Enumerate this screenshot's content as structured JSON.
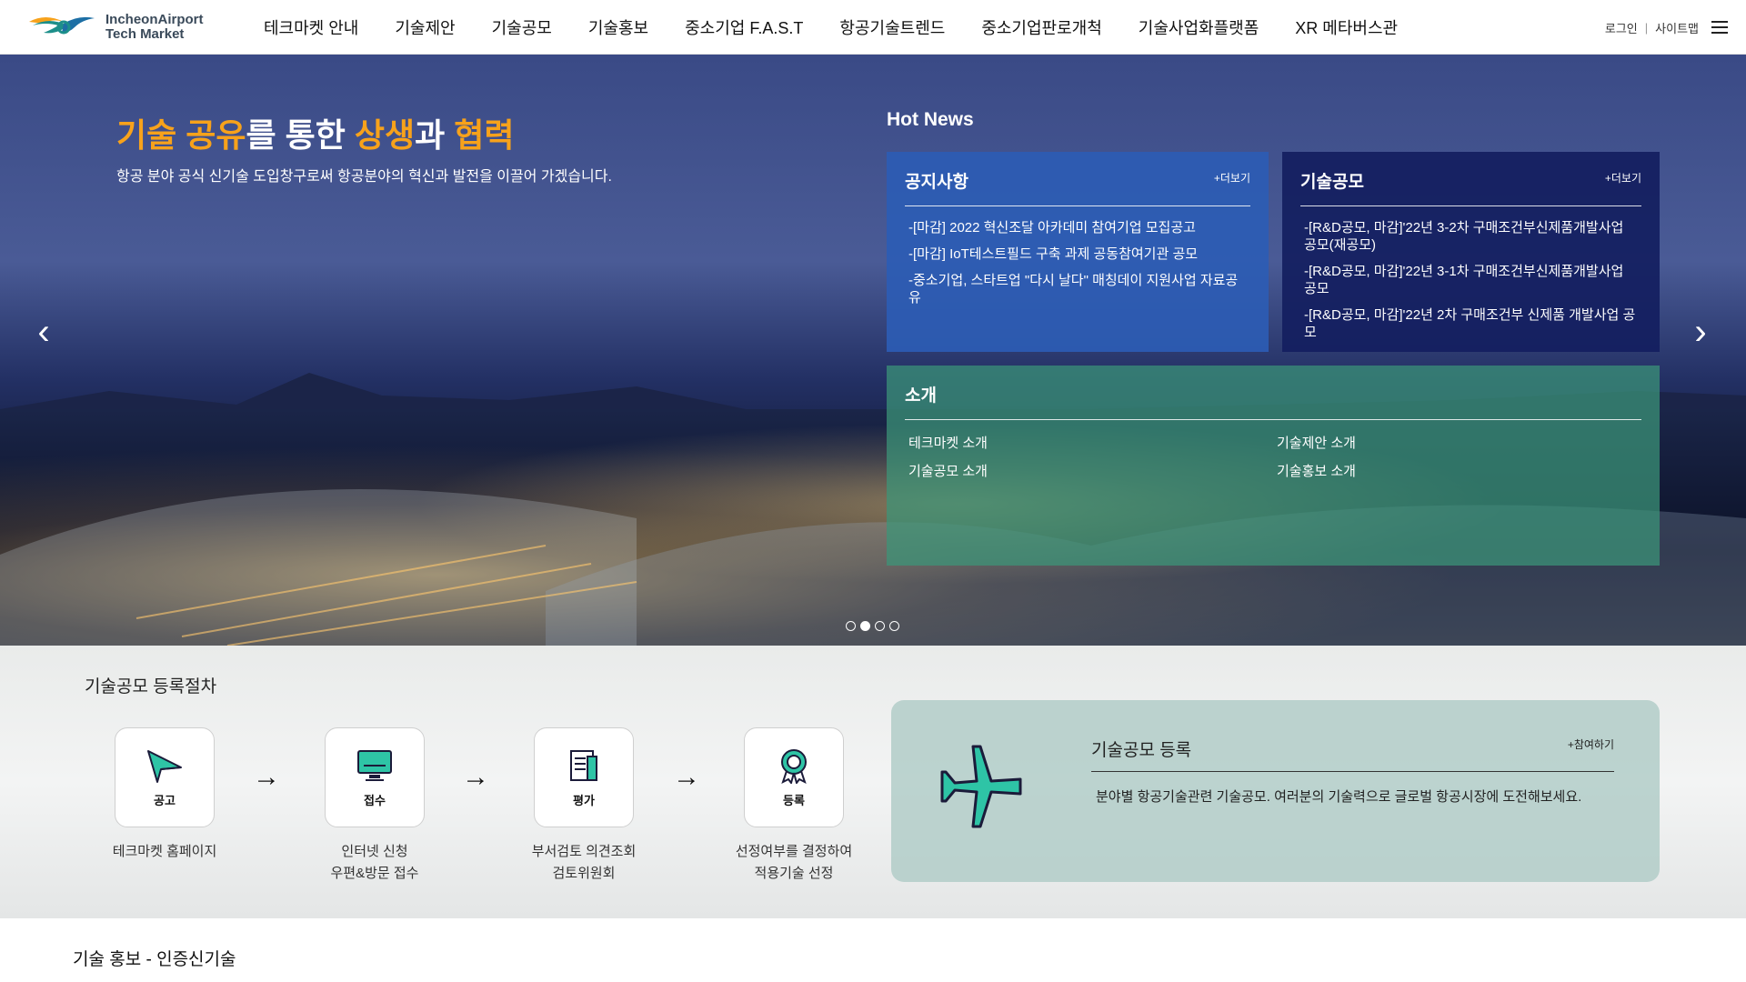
{
  "header": {
    "logo_line1": "IncheonAirport",
    "logo_line2": "Tech Market",
    "nav": [
      "테크마켓 안내",
      "기술제안",
      "기술공모",
      "기술홍보",
      "중소기업 F.A.S.T",
      "항공기술트렌드",
      "중소기업판로개척",
      "기술사업화플랫폼",
      "XR 메타버스관"
    ],
    "login": "로그인",
    "divider": "|",
    "sitemap": "사이트맵"
  },
  "hero": {
    "headline_part1": "기술 공유",
    "headline_part2": "를 통한 ",
    "headline_part3": "상생",
    "headline_part4": "과 ",
    "headline_part5": "협력",
    "subtitle": "항공 분야 공식 신기술 도입창구로써 항공분야의 혁신과 발전을 이끌어 가겠습니다.",
    "prev_icon": "chevron-left-icon",
    "next_icon": "chevron-right-icon",
    "slide_count": 4,
    "active_slide": 2
  },
  "hot_news": {
    "title": "Hot News",
    "notice": {
      "title": "공지사항",
      "more": "+더보기",
      "items": [
        "-[마감] 2022 혁신조달 아카데미 참여기업 모집공고",
        "-[마감] IoT테스트필드 구축 과제 공동참여기관 공모",
        "-중소기업, 스타트업 \"다시 날다\" 매칭데이 지원사업 자료공유"
      ]
    },
    "contest": {
      "title": "기술공모",
      "more": "+더보기",
      "items": [
        "-[R&D공모, 마감]'22년 3-2차 구매조건부신제품개발사업 공모(재공모)",
        "-[R&D공모, 마감]'22년 3-1차 구매조건부신제품개발사업 공모",
        "-[R&D공모, 마감]'22년 2차 구매조건부 신제품 개발사업 공모"
      ]
    },
    "intro": {
      "title": "소개",
      "links": [
        "테크마켓 소개",
        "기술제안 소개",
        "기술공모 소개",
        "기술홍보 소개"
      ]
    }
  },
  "process": {
    "title": "기술공모 등록절차",
    "steps": [
      {
        "label": "공고",
        "icon": "paper-plane-icon",
        "desc1": "테크마켓 홈페이지",
        "desc2": ""
      },
      {
        "label": "접수",
        "icon": "monitor-icon",
        "desc1": "인터넷 신청",
        "desc2": "우편&방문 접수"
      },
      {
        "label": "평가",
        "icon": "document-icon",
        "desc1": "부서검토 의견조회",
        "desc2": "검토위원회"
      },
      {
        "label": "등록",
        "icon": "award-badge-icon",
        "desc1": "선정여부를 결정하여",
        "desc2": "적용기술 선정"
      }
    ],
    "arrow": "→",
    "card": {
      "title": "기술공모 등록",
      "join": "+참여하기",
      "desc": "분야별 항공기술관련 기술공모. 여러분의 기술력으로 글로벌 항공시장에 도전해보세요.",
      "icon": "airplane-icon"
    }
  },
  "bottom": {
    "title": "기술 홍보 - 인증신기술"
  },
  "colors": {
    "accent_orange": "#f7a21b",
    "notice_blue": "#2d5cb4",
    "contest_navy": "#141e5f",
    "intro_green": "#3c9678",
    "teal_icon": "#2ec4a6"
  }
}
